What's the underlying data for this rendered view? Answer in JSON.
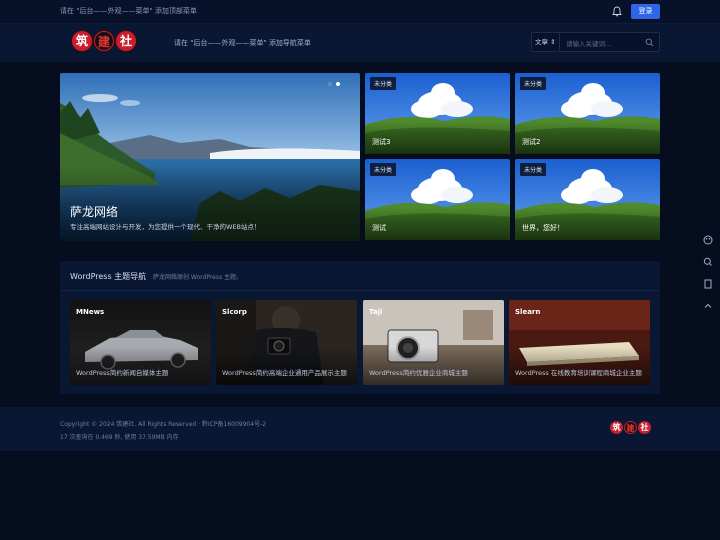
{
  "topbar": {
    "message": "请在 \"后台——外观——菜单\" 添加顶部菜单",
    "login_label": "登录"
  },
  "header": {
    "logo_chars": [
      "筑",
      "建",
      "社"
    ],
    "nav_tip": "请在 \"后台——外观——菜单\" 添加导航菜单",
    "search_type": "文章 ⇕",
    "search_placeholder": "请输入关键词..."
  },
  "hero": {
    "title": "萨龙网络",
    "subtitle": "专注高端网站设计与开发，为您提供一个现代、干净的WEB站点！"
  },
  "tiles": [
    {
      "badge": "未分类",
      "title": "测试3"
    },
    {
      "badge": "未分类",
      "title": "测试2"
    },
    {
      "badge": "未分类",
      "title": "测试"
    },
    {
      "badge": "未分类",
      "title": "世界，您好！"
    }
  ],
  "section": {
    "title": "WordPress 主题导航",
    "desc": "萨龙网络原创 WordPress 主题。"
  },
  "cards": [
    {
      "name": "MNews",
      "desc": "WordPress简约新闻自媒体主题"
    },
    {
      "name": "Slcorp",
      "desc": "WordPress简约高端企业通用产品展示主题"
    },
    {
      "name": "Taji",
      "desc": "WordPress简约优雅企业商城主题"
    },
    {
      "name": "Slearn",
      "desc": "WordPress 在线教育培训课程商城企业主题"
    }
  ],
  "footer": {
    "copyright": "Copyright © 2024 筑建社. All Rights Reserved · 黔ICP备16009904号-2",
    "stats": "17 次查询在 0.469 秒, 使用 37.59MB 内存",
    "logo_chars": [
      "筑",
      "建",
      "社"
    ]
  },
  "colors": {
    "accent": "#2f66e8",
    "background": "#050d1e",
    "panel": "#0a1733",
    "logo_red": "#c81e2e"
  },
  "icons": [
    "bell-icon",
    "search-icon",
    "palette-icon",
    "magnifier-icon",
    "bookmark-icon",
    "arrow-up-icon"
  ]
}
